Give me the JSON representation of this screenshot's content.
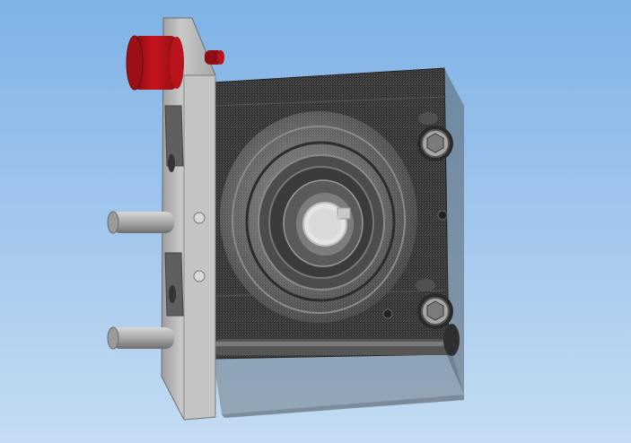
{
  "viewport": {
    "background_top": "#7FB2E6",
    "background_bottom": "#C4DCF3"
  },
  "model": {
    "icon": "cad-assembly-render",
    "colors": {
      "housing": "#353535",
      "housing_edge": "#1E1E1E",
      "translucent_body": "#6F7C86",
      "bracket_plate": "#B4B4B4",
      "bracket_shadow": "#8E8E8E",
      "knob": "#B8121A",
      "knob_shadow": "#7D0C12",
      "pin": "#A9A9A9",
      "shaft_hole": "#E4E4E4",
      "bolt_head": "#A6A6A6"
    }
  }
}
